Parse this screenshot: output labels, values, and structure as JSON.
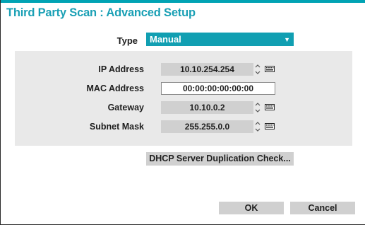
{
  "dialog": {
    "title": "Third Party Scan : Advanced Setup",
    "accent_color": "#00a3b4"
  },
  "type": {
    "label": "Type",
    "selected": "Manual",
    "color": "#119fb2"
  },
  "network": {
    "ip_address": {
      "label": "IP Address",
      "value": "10.10.254.254"
    },
    "mac_address": {
      "label": "MAC Address",
      "value": "00:00:00:00:00:00"
    },
    "gateway": {
      "label": "Gateway",
      "value": "10.10.0.2"
    },
    "subnet_mask": {
      "label": "Subnet Mask",
      "value": "255.255.0.0"
    }
  },
  "icons": {
    "spinner": "up-down-spinner-icon",
    "keyboard": "keyboard-icon",
    "dropdown": "chevron-down-icon"
  },
  "buttons": {
    "dhcp_check": "DHCP Server Duplication Check...",
    "ok": "OK",
    "cancel": "Cancel"
  }
}
